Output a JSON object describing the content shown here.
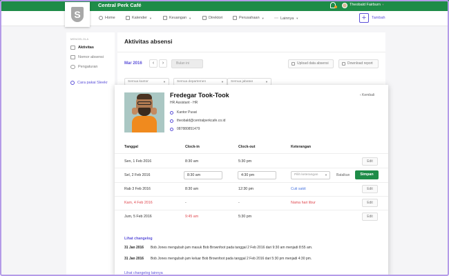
{
  "app": {
    "name": "Central Perk Café",
    "logo_letter": "S",
    "user_name": "Theobald Fairburn"
  },
  "nav": {
    "items": [
      {
        "label": "Home",
        "icon": "home-icon"
      },
      {
        "label": "Kalender",
        "icon": "calendar-icon"
      },
      {
        "label": "Keuangan",
        "icon": "finance-icon"
      },
      {
        "label": "Direktori",
        "icon": "directory-icon"
      },
      {
        "label": "Perusahaan",
        "icon": "building-icon"
      },
      {
        "label": "Lainnya",
        "icon": "more-icon"
      }
    ],
    "add_label": "Tambah",
    "add_symbol": "+"
  },
  "sidebar": {
    "heading": "MENGELOLA",
    "items": [
      {
        "label": "Aktivitas",
        "active": true
      },
      {
        "label": "Nomor absensi",
        "active": false
      },
      {
        "label": "Pengaturan",
        "active": false
      }
    ],
    "help_link": "Cara pakai Sleekr"
  },
  "main": {
    "title": "Aktivitas absensi",
    "month": "Mar 2016",
    "prev_arrow": "‹",
    "next_arrow": "›",
    "this_month": "Bulan ini",
    "upload_label": "Upload data absensi",
    "download_label": "Download report",
    "filters": [
      "Semua kantor",
      "Semua departemen",
      "Semua jabatan"
    ]
  },
  "employee": {
    "name": "Fredegar Took-Took",
    "role": "HR Assistant - HR",
    "office": "Kantor Pusat",
    "email": "theobald@centralperkcafe.co.id",
    "phone": "087880851479",
    "back_label": "‹  Kembali"
  },
  "table": {
    "headers": [
      "Tanggal",
      "Clock-in",
      "Clock-out",
      "Keterangan"
    ],
    "rows": [
      {
        "date": "Sen, 1 Feb 2016",
        "clock_in": "8:30 am",
        "clock_out": "5:30 pm",
        "note": "",
        "action": "Edit"
      },
      {
        "date": "Sel, 2 Feb 2016",
        "clock_in": "8:30 am",
        "clock_out": "4:30 pm",
        "note_placeholder": "Pilih keterangan",
        "cancel": "Batalkan",
        "save": "Simpan"
      },
      {
        "date": "Rab 3 Feb 2016",
        "clock_in": "8:30 am",
        "clock_out": "12:30 pm",
        "note": "Cuti sakit",
        "action": "Edit"
      },
      {
        "date": "Kam, 4 Feb 2016",
        "clock_in": "-",
        "clock_out": "-",
        "note": "Nama hari libur",
        "action": "Edit"
      },
      {
        "date": "Jum, 5 Feb 2016",
        "clock_in": "9:45 am",
        "clock_out": "5:30 pm",
        "note": "",
        "action": "Edit"
      }
    ]
  },
  "changelog": {
    "title": "Lihat changelog",
    "entries": [
      {
        "date": "31 Jan 2016",
        "text": "Bob Jones mengubah jam masuk Bob Brownfoot pada tanggal 2 Feb 2016 dari 9:30 am menjadi 8:55 am."
      },
      {
        "date": "31 Jan 2016",
        "text": "Bob Jones mengubah jam keluar Bob Brownfoot pada tanggal 2 Feb 2016  dari 5:30 pm menjadi 4:30 pm."
      }
    ],
    "more_link": "Lihat changelog lainnya"
  },
  "colors": {
    "brand_green": "#1e8c48",
    "accent_purple": "#5a4fd8",
    "holiday_red": "#e0484f",
    "link_blue": "#4a76e0"
  }
}
